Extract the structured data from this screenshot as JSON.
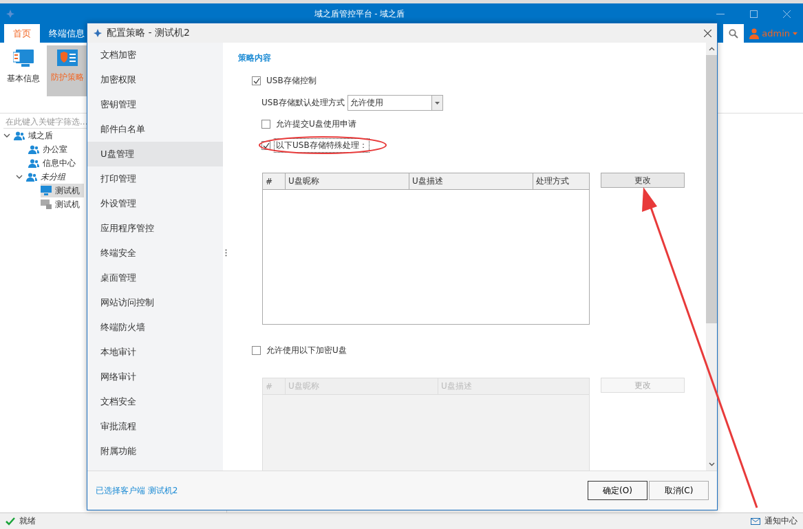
{
  "app": {
    "title": "域之盾管控平台 - 域之盾",
    "tabs": [
      {
        "label": "首页",
        "selected": true
      },
      {
        "label": "终端信息",
        "selected": false
      }
    ],
    "user": "admin",
    "ribbon": [
      {
        "label": "基本信息",
        "selected": false,
        "kind": "info"
      },
      {
        "label": "防护策略",
        "selected": true,
        "kind": "shield"
      }
    ],
    "filter": {
      "placeholder": "在此键入关键字筛选..."
    },
    "tree": [
      {
        "label": "域之盾",
        "kind": "group",
        "expanded": true,
        "italic": false,
        "selected": false,
        "children": [
          {
            "label": "办公室",
            "kind": "group",
            "italic": false,
            "selected": false
          },
          {
            "label": "信息中心",
            "kind": "group",
            "italic": false,
            "selected": false
          },
          {
            "label": "未分组",
            "kind": "group",
            "expanded": true,
            "italic": true,
            "selected": false,
            "children": [
              {
                "label": "测试机",
                "kind": "computer",
                "selected": true
              },
              {
                "label": "测试机",
                "kind": "locked",
                "selected": false
              }
            ]
          }
        ]
      }
    ],
    "status": "就绪",
    "notifications": "通知中心"
  },
  "dialog": {
    "title": "配置策略 - 测试机2",
    "nav": [
      {
        "label": "文档加密",
        "selected": false
      },
      {
        "label": "加密权限",
        "selected": false
      },
      {
        "label": "密钥管理",
        "selected": false
      },
      {
        "label": "邮件白名单",
        "selected": false
      },
      {
        "label": "U盘管理",
        "selected": true
      },
      {
        "label": "打印管理",
        "selected": false
      },
      {
        "label": "外设管理",
        "selected": false
      },
      {
        "label": "应用程序管控",
        "selected": false
      },
      {
        "label": "终端安全",
        "selected": false
      },
      {
        "label": "桌面管理",
        "selected": false
      },
      {
        "label": "网站访问控制",
        "selected": false
      },
      {
        "label": "终端防火墙",
        "selected": false
      },
      {
        "label": "本地审计",
        "selected": false
      },
      {
        "label": "网络审计",
        "selected": false
      },
      {
        "label": "文档安全",
        "selected": false
      },
      {
        "label": "审批流程",
        "selected": false
      },
      {
        "label": "附属功能",
        "selected": false
      }
    ],
    "section_title": "策略内容",
    "items": [
      {
        "kind": "checkbox",
        "label": "USB存储控制",
        "checked": true,
        "indent": false,
        "focused": false
      },
      {
        "kind": "select",
        "label": "USB存储默认处理方式",
        "value": "允许使用"
      },
      {
        "kind": "checkbox",
        "label": "允许提交U盘使用申请",
        "checked": false,
        "indent": true,
        "focused": false
      },
      {
        "kind": "checkbox",
        "label": "以下USB存储特殊处理：",
        "checked": true,
        "indent": true,
        "focused": true,
        "circled": true
      },
      {
        "kind": "table",
        "disabled": false,
        "columns": [
          "#",
          "U盘昵称",
          "U盘描述",
          "处理方式"
        ],
        "button": "更改"
      },
      {
        "kind": "checkbox",
        "label": "允许使用以下加密U盘",
        "checked": false,
        "indent": false,
        "focused": false
      },
      {
        "kind": "table",
        "disabled": true,
        "columns": [
          "#",
          "U盘昵称",
          "U盘描述"
        ],
        "button": "更改"
      }
    ],
    "selected_client": "已选择客户端 测试机2",
    "buttons": [
      {
        "label": "确定(O)",
        "default": true
      },
      {
        "label": "取消(C)",
        "default": false
      }
    ]
  },
  "annotation": {
    "arrow": true
  }
}
